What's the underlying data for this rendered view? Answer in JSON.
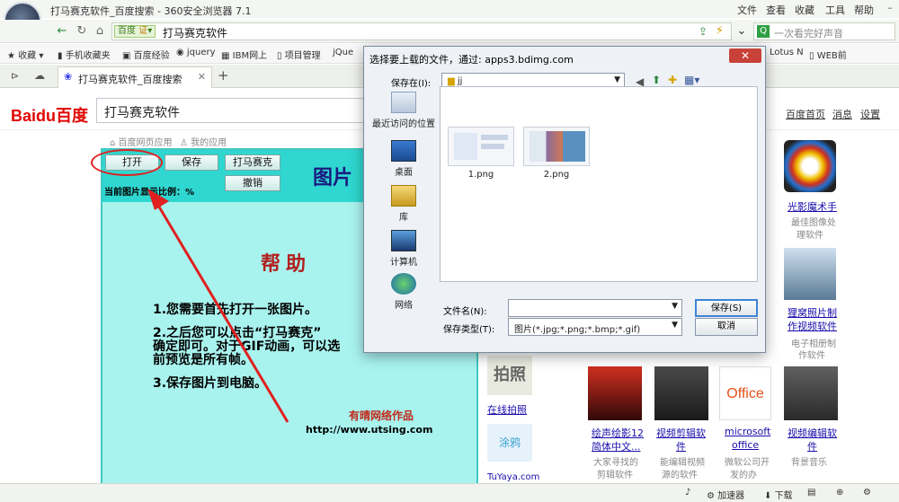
{
  "browser": {
    "title": "打马赛克软件_百度搜索 - 360安全浏览器 7.1",
    "menu": [
      "文件",
      "查看",
      "收藏",
      "工具",
      "帮助"
    ],
    "url_tag": "百度",
    "url_tag2": "证",
    "url_text": "打马赛克软件",
    "search_placeholder": "一次看完好声音",
    "bookmarks": [
      "收藏",
      "手机收藏夹",
      "百度经验",
      "jquery",
      "IBM网上",
      "项目管理",
      "jQue",
      "Lotus N",
      "WEB前"
    ],
    "tab_title": "打马赛克软件_百度搜索",
    "new_tab": "+"
  },
  "baidu": {
    "logo": "Baidu百度",
    "search_value": "打马赛克软件",
    "links": [
      "百度首页",
      "消息",
      "设置"
    ],
    "crumbs": [
      "百度网页应用",
      "我的应用"
    ]
  },
  "app": {
    "buttons": {
      "open": "打开",
      "save": "保存",
      "mosaic": "打马赛克",
      "undo": "撤销"
    },
    "title": "图片",
    "ratio": "当前图片显示比例：%",
    "help_title": "帮助",
    "steps": [
      "1.您需要首先打开一张图片。",
      "2.之后您可以点击“打马赛克”",
      "确定即可。对于GIF动画，可以选",
      "前预览是所有帧。",
      "3.保存图片到电脑。"
    ],
    "author": "有晴网络作品",
    "website": "http://www.utsing.com"
  },
  "right_column": {
    "items": [
      {
        "title": "光影魔术手",
        "desc1": "最佳图像处",
        "desc2": "理软件"
      },
      {
        "title": "狸窝照片制",
        "title2": "作视频软件",
        "desc1": "电子相册制",
        "desc2": "作软件"
      },
      {
        "title": "拍照",
        "desc1": "在线拍照"
      },
      {
        "title": "涂鸦",
        "desc1": "TuYaya.com"
      },
      {
        "title": "绘声绘影12",
        "title2": "简体中文...",
        "desc1": "大家寻找的",
        "desc2": "剪辑软件"
      },
      {
        "title": "视频剪辑软",
        "title2": "件",
        "desc1": "能编辑视频",
        "desc2": "源的软件"
      },
      {
        "title": "microsoft",
        "title2": "office",
        "desc1": "微软公司开",
        "desc2": "发的办"
      },
      {
        "title": "视频编辑软",
        "title2": "件",
        "desc1": "背景音乐"
      }
    ]
  },
  "dialog": {
    "title": "选择要上载的文件，通过: apps3.bdimg.com",
    "close": "✕",
    "save_in_label": "保存在(I):",
    "folder": "jj",
    "places": [
      "最近访问的位置",
      "桌面",
      "库",
      "计算机",
      "网络"
    ],
    "files": [
      "1.png",
      "2.png"
    ],
    "filename_label": "文件名(N):",
    "filename_value": "",
    "filetype_label": "保存类型(T):",
    "filetype_value": "图片(*.jpg;*.png;*.bmp;*.gif)",
    "save_button": "保存(S)",
    "cancel_button": "取消"
  },
  "statusbar": {
    "items": [
      "加速器",
      "下载"
    ]
  },
  "colors": {
    "app_bg": "#a9f3ee",
    "app_top": "#2fd7d0",
    "arrow": "#e02020",
    "baidu_red": "#e10602"
  }
}
